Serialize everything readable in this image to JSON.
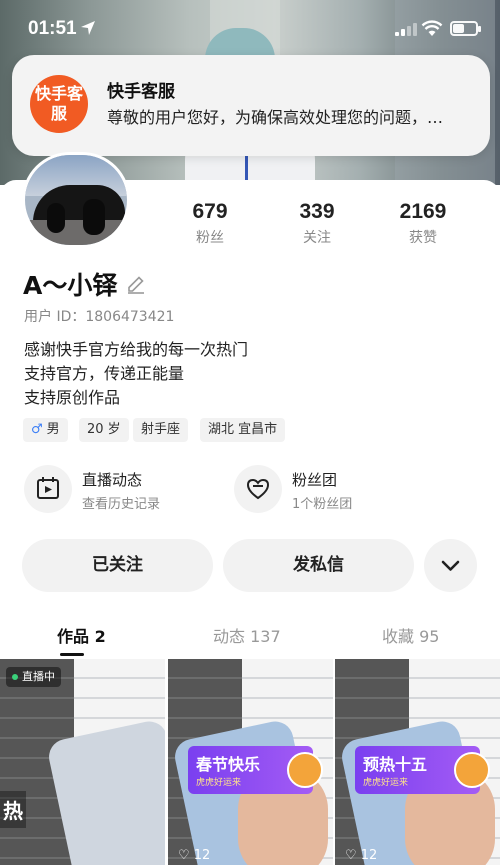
{
  "status_bar": {
    "time": "01:51"
  },
  "notification": {
    "app_icon_text": "快手客服",
    "title": "快手客服",
    "body": "尊敬的用户您好，为确保高效处理您的问题，…"
  },
  "profile": {
    "name": "A～小铎",
    "user_id": "用户 ID：1806473421",
    "bio": [
      "感谢快手官方给我的每一次热门",
      "支持官方，传递正能量",
      "支持原创作品"
    ],
    "stats": [
      {
        "value": "679",
        "label": "粉丝"
      },
      {
        "value": "339",
        "label": "关注"
      },
      {
        "value": "2169",
        "label": "获赞"
      }
    ],
    "tags": [
      {
        "icon": "male-icon",
        "icon_char": "♂",
        "text": "男"
      },
      {
        "text": "20 岁"
      },
      {
        "text": "射手座"
      },
      {
        "text": "湖北 宜昌市"
      }
    ]
  },
  "features": [
    {
      "icon": "calendar-live-icon",
      "title": "直播动态",
      "subtitle": "查看历史记录"
    },
    {
      "icon": "heart-badge-icon",
      "title": "粉丝团",
      "subtitle": "1个粉丝团"
    }
  ],
  "actions": {
    "follow": "已关注",
    "message": "发私信"
  },
  "tabs": [
    {
      "label": "作品 2",
      "active": true
    },
    {
      "label": "动态 137",
      "active": false
    },
    {
      "label": "收藏 95",
      "active": false
    }
  ],
  "grid": [
    {
      "badge": "直播中",
      "overlay": "热",
      "likes": ""
    },
    {
      "banner_title": "春节快乐",
      "banner_sub": "虎虎好运来",
      "likes": "♡ 12"
    },
    {
      "banner_title": "预热十五",
      "banner_sub": "虎虎好运来",
      "likes": "♡ 12"
    }
  ],
  "colors": {
    "accent": "#f15b23",
    "male": "#3b7ef6",
    "banner": "#7a3ff0"
  }
}
